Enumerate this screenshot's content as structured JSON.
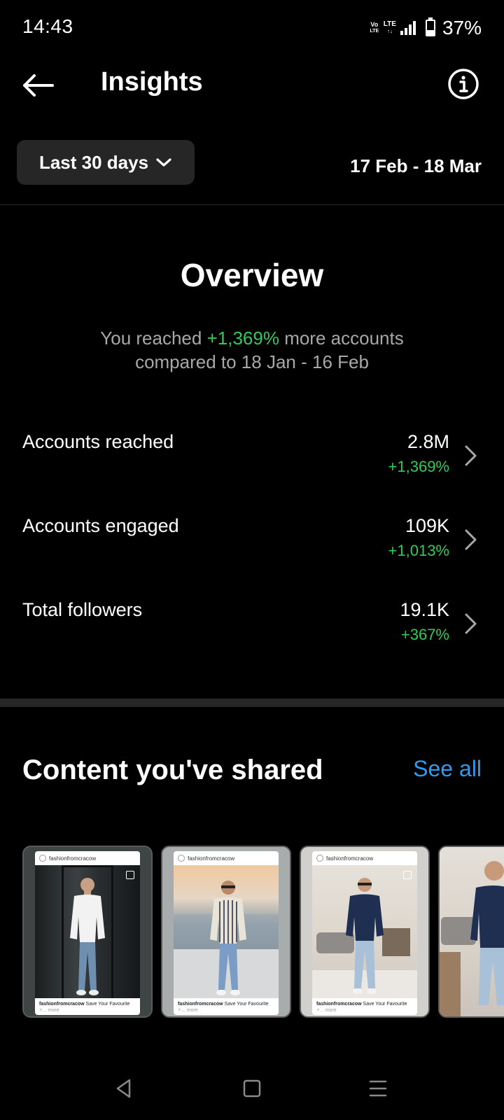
{
  "status_bar": {
    "time": "14:43",
    "volte_top": "Vo",
    "volte_bottom": "LTE",
    "network_top": "LTE",
    "network_bottom": "↑↓",
    "battery_level": 0.37,
    "battery_pct": "37%"
  },
  "header": {
    "title": "Insights",
    "back_icon": "arrow-left-icon",
    "info_icon": "info-circle-icon"
  },
  "filter": {
    "range_label": "Last 30 days",
    "range_icon": "chevron-down-icon",
    "date_range": "17 Feb - 18 Mar"
  },
  "overview": {
    "title": "Overview",
    "summary_prefix": "You reached",
    "summary_highlight": "+1,369%",
    "summary_suffix": "more accounts",
    "summary_line2": "compared to 18 Jan - 16 Feb",
    "metrics": [
      {
        "label": "Accounts reached",
        "value": "2.8M",
        "change": "+1,369%"
      },
      {
        "label": "Accounts engaged",
        "value": "109K",
        "change": "+1,013%"
      },
      {
        "label": "Total followers",
        "value": "19.1K",
        "change": "+367%"
      }
    ]
  },
  "content": {
    "title": "Content you've shared",
    "see_all": "See all",
    "posts": [
      {
        "account": "fashionfromcracow",
        "caption_handle": "fashionfromcracow",
        "caption_text": "Save Your Favourite",
        "caption_more": "⚡... more"
      },
      {
        "account": "fashionfromcracow",
        "caption_handle": "fashionfromcracow",
        "caption_text": "Save Your Favourite",
        "caption_more": "⚡... more"
      },
      {
        "account": "fashionfromcracow",
        "caption_handle": "fashionfromcracow",
        "caption_text": "Save Your Favourite",
        "caption_more": "⚡... more"
      }
    ]
  },
  "nav_bar": {
    "back": "triangle-back-icon",
    "home": "square-home-icon",
    "menu": "menu-lines-icon"
  },
  "colors": {
    "background": "#000000",
    "positive": "#2ecc59",
    "link": "#2f9bf0",
    "muted": "#a8a8a8",
    "surface": "#262626"
  }
}
